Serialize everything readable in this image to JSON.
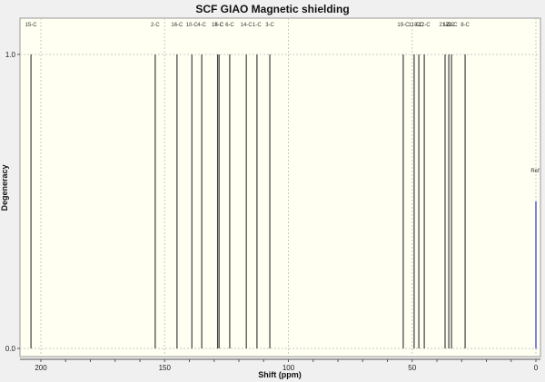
{
  "chart_data": {
    "type": "bar",
    "title": "SCF GIAO Magnetic shielding",
    "xlabel": "Shift (ppm)",
    "ylabel": "Degeneracy",
    "xlim": [
      210,
      -2
    ],
    "ylim": [
      0,
      1.0
    ],
    "x_reversed": true,
    "grid": true,
    "xticks": [
      200,
      150,
      100,
      50,
      0
    ],
    "yticks": [
      0.0,
      1.0
    ],
    "ytick_labels": [
      "0.0",
      "1.0"
    ],
    "peaks": [
      {
        "label": "15-C",
        "shift": 204.0,
        "degeneracy": 1.0
      },
      {
        "label": "2-C",
        "shift": 153.8,
        "degeneracy": 1.0
      },
      {
        "label": "16-C",
        "shift": 145.0,
        "degeneracy": 1.0
      },
      {
        "label": "10-C",
        "shift": 139.0,
        "degeneracy": 1.0
      },
      {
        "label": "4-C",
        "shift": 135.0,
        "degeneracy": 1.0
      },
      {
        "label": "18-C",
        "shift": 128.6,
        "degeneracy": 1.0
      },
      {
        "label": "5-C",
        "shift": 128.0,
        "degeneracy": 1.0
      },
      {
        "label": "6-C",
        "shift": 123.7,
        "degeneracy": 1.0
      },
      {
        "label": "14-C",
        "shift": 117.0,
        "degeneracy": 1.0
      },
      {
        "label": "1-C",
        "shift": 112.7,
        "degeneracy": 1.0
      },
      {
        "label": "3-C",
        "shift": 107.5,
        "degeneracy": 1.0
      },
      {
        "label": "19-C",
        "shift": 53.6,
        "degeneracy": 1.0
      },
      {
        "label": "11-C",
        "shift": 49.2,
        "degeneracy": 1.0
      },
      {
        "label": "9-C",
        "shift": 47.3,
        "degeneracy": 1.0
      },
      {
        "label": "12-C",
        "shift": 45.1,
        "degeneracy": 1.0
      },
      {
        "label": "21-C",
        "shift": 36.7,
        "degeneracy": 1.0
      },
      {
        "label": "17-C",
        "shift": 35.2,
        "degeneracy": 1.0
      },
      {
        "label": "20-C",
        "shift": 34.1,
        "degeneracy": 1.0
      },
      {
        "label": "8-C",
        "shift": 28.6,
        "degeneracy": 1.0
      }
    ],
    "reference": {
      "label": "Ref",
      "shift": 0.0,
      "degeneracy": 0.5,
      "color": "#8080e0"
    },
    "colors": {
      "peak": "#404040",
      "plot_bg": "#fffff2",
      "grid": "#c8c8c8"
    }
  }
}
